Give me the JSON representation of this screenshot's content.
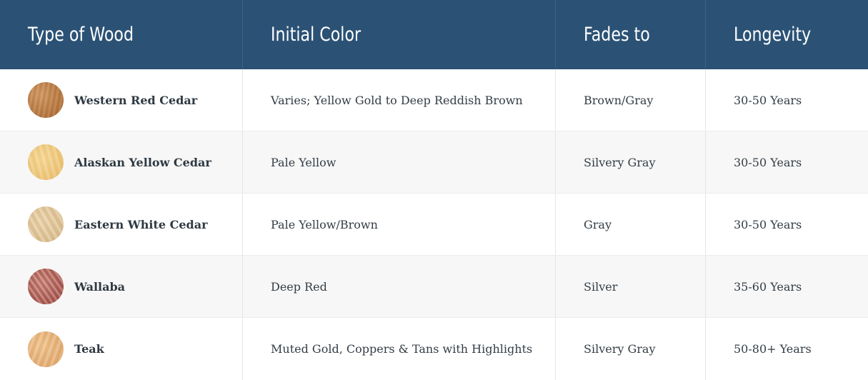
{
  "table": {
    "headers": [
      "Type of Wood",
      "Initial Color",
      "Fades to",
      "Longevity"
    ],
    "rows": [
      {
        "wood": "Western Red Cedar",
        "initial_color": "Varies; Yellow Gold to Deep Reddish Brown",
        "fades_to": "Brown/Gray",
        "longevity": "30-50 Years",
        "swatch_icon": "western-red-cedar-swatch",
        "swatch_color": "#b8773f"
      },
      {
        "wood": "Alaskan Yellow Cedar",
        "initial_color": "Pale Yellow",
        "fades_to": "Silvery Gray",
        "longevity": "30-50 Years",
        "swatch_icon": "alaskan-yellow-cedar-swatch",
        "swatch_color": "#ecc477"
      },
      {
        "wood": "Eastern White Cedar",
        "initial_color": "Pale Yellow/Brown",
        "fades_to": "Gray",
        "longevity": "30-50 Years",
        "swatch_icon": "eastern-white-cedar-swatch",
        "swatch_color": "#dcc092"
      },
      {
        "wood": "Wallaba",
        "initial_color": "Deep Red",
        "fades_to": "Silver",
        "longevity": "35-60 Years",
        "swatch_icon": "wallaba-swatch",
        "swatch_color": "#a85a52"
      },
      {
        "wood": "Teak",
        "initial_color": "Muted Gold, Coppers & Tans with Highlights",
        "fades_to": "Silvery Gray",
        "longevity": "50-80+ Years",
        "swatch_icon": "teak-swatch",
        "swatch_color": "#e3ad74"
      }
    ]
  },
  "colors": {
    "header_bg": "#2b5275",
    "header_text": "#ffffff",
    "alt_row_bg": "#f7f7f7",
    "body_text": "#333d45"
  }
}
